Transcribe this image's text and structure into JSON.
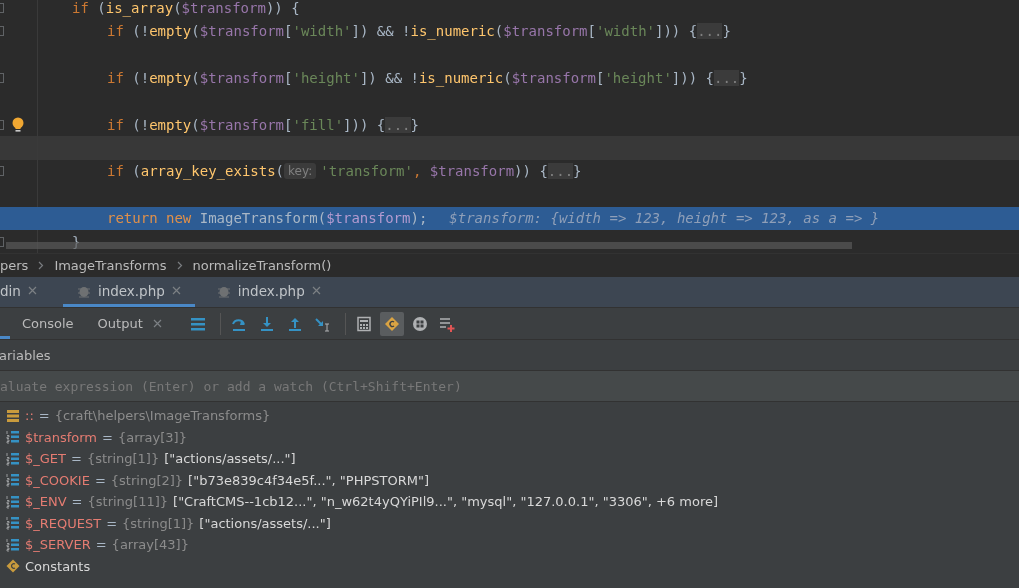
{
  "code": [
    {
      "kind": "code",
      "bulb": false,
      "tokens": [
        {
          "kind": "kw",
          "text": "if "
        },
        {
          "kind": "plain",
          "text": "("
        },
        {
          "kind": "fn",
          "text": "is_array"
        },
        {
          "kind": "plain",
          "text": "("
        },
        {
          "kind": "var",
          "text": "$transform"
        },
        {
          "kind": "plain",
          "text": ")) {"
        }
      ],
      "children": [
        {
          "kind": "code",
          "bulb": false,
          "tokens": [
            {
              "kind": "kw",
              "text": "if "
            },
            {
              "kind": "plain",
              "text": "(!"
            },
            {
              "kind": "fn",
              "text": "empty"
            },
            {
              "kind": "plain",
              "text": "("
            },
            {
              "kind": "var",
              "text": "$transform"
            },
            {
              "kind": "plain",
              "text": "["
            },
            {
              "kind": "str",
              "text": "'width'"
            },
            {
              "kind": "plain",
              "text": "]) && !"
            },
            {
              "kind": "fn",
              "text": "is_numeric"
            },
            {
              "kind": "plain",
              "text": "("
            },
            {
              "kind": "var",
              "text": "$transform"
            },
            {
              "kind": "plain",
              "text": "["
            },
            {
              "kind": "str",
              "text": "'width'"
            },
            {
              "kind": "plain",
              "text": "])) {"
            },
            {
              "kind": "fold",
              "text": "..."
            },
            {
              "kind": "plain",
              "text": "}"
            }
          ]
        },
        {
          "kind": "blank"
        },
        {
          "kind": "code",
          "bulb": false,
          "tokens": [
            {
              "kind": "kw",
              "text": "if "
            },
            {
              "kind": "plain",
              "text": "(!"
            },
            {
              "kind": "fn",
              "text": "empty"
            },
            {
              "kind": "plain",
              "text": "("
            },
            {
              "kind": "var",
              "text": "$transform"
            },
            {
              "kind": "plain",
              "text": "["
            },
            {
              "kind": "str",
              "text": "'height'"
            },
            {
              "kind": "plain",
              "text": "]) && !"
            },
            {
              "kind": "fn",
              "text": "is_numeric"
            },
            {
              "kind": "plain",
              "text": "("
            },
            {
              "kind": "var",
              "text": "$transform"
            },
            {
              "kind": "plain",
              "text": "["
            },
            {
              "kind": "str",
              "text": "'height'"
            },
            {
              "kind": "plain",
              "text": "])) {"
            },
            {
              "kind": "fold",
              "text": "..."
            },
            {
              "kind": "plain",
              "text": "}"
            }
          ]
        },
        {
          "kind": "blank"
        },
        {
          "kind": "code",
          "bulb": true,
          "tokens": [
            {
              "kind": "kw",
              "text": "if "
            },
            {
              "kind": "plain",
              "text": "(!"
            },
            {
              "kind": "fn",
              "text": "empty"
            },
            {
              "kind": "plain",
              "text": "("
            },
            {
              "kind": "var",
              "text": "$transform"
            },
            {
              "kind": "plain",
              "text": "["
            },
            {
              "kind": "str",
              "text": "'fill'"
            },
            {
              "kind": "plain",
              "text": "])) {"
            },
            {
              "kind": "fold",
              "text": "..."
            },
            {
              "kind": "plain",
              "text": "}"
            }
          ]
        },
        {
          "kind": "blank",
          "caret_line": true
        },
        {
          "kind": "code",
          "bulb": false,
          "tokens": [
            {
              "kind": "kw",
              "text": "if "
            },
            {
              "kind": "plain",
              "text": "("
            },
            {
              "kind": "fn",
              "text": "array_key_exists"
            },
            {
              "kind": "plain",
              "text": "("
            },
            {
              "kind": "hint",
              "text": "key:"
            },
            {
              "kind": "str",
              "text": "'transform'"
            },
            {
              "kind": "kw",
              "text": ", "
            },
            {
              "kind": "var",
              "text": "$transform"
            },
            {
              "kind": "plain",
              "text": ")) {"
            },
            {
              "kind": "fold",
              "text": "..."
            },
            {
              "kind": "plain",
              "text": "}"
            }
          ]
        },
        {
          "kind": "blank"
        },
        {
          "kind": "code",
          "bulb": false,
          "execution_line": true,
          "tokens": [
            {
              "kind": "kw",
              "text": "return new "
            },
            {
              "kind": "plain",
              "text": "ImageTransform("
            },
            {
              "kind": "var",
              "text": "$transform"
            },
            {
              "kind": "plain",
              "text": ");"
            },
            {
              "kind": "inline",
              "text": "$transform: {width => 123, height => 123, as a => }"
            }
          ]
        }
      ]
    },
    {
      "kind": "code",
      "bulb": false,
      "tokens": [
        {
          "kind": "plain",
          "text": "}"
        }
      ]
    }
  ],
  "breadcrumbs": [
    "pers",
    "ImageTransforms",
    "normalizeTransform()"
  ],
  "session_tabs": [
    {
      "label": "din",
      "selected": false,
      "icon": false
    },
    {
      "label": "index.php",
      "selected": true,
      "icon": true
    },
    {
      "label": "index.php",
      "selected": false,
      "icon": true
    }
  ],
  "debug_tabs": [
    {
      "label": "Console",
      "closable": false
    },
    {
      "label": "Output",
      "closable": true
    }
  ],
  "toolbar": [
    {
      "kind": "frames",
      "selected": false
    },
    {
      "kind": "separator"
    },
    {
      "kind": "step-over",
      "selected": false
    },
    {
      "kind": "step-into",
      "selected": false
    },
    {
      "kind": "step-out",
      "selected": false
    },
    {
      "kind": "run-to-cursor",
      "selected": false
    },
    {
      "kind": "separator"
    },
    {
      "kind": "evaluate",
      "selected": false
    },
    {
      "kind": "constants",
      "selected": true
    },
    {
      "kind": "grid",
      "selected": false
    },
    {
      "kind": "add-watch",
      "selected": false
    }
  ],
  "variables": {
    "title": "ariables",
    "evaluate_placeholder": "aluate expression (Enter) or add a watch (Ctrl+Shift+Enter)",
    "items": [
      {
        "kind": "object",
        "name": "::",
        "operator": "=",
        "type": "{craft\\helpers\\ImageTransforms}"
      },
      {
        "kind": "array",
        "name": "$transform",
        "operator": "=",
        "type": "{array[3]}"
      },
      {
        "kind": "array",
        "name": "$_GET",
        "operator": "=",
        "type": "{string[1]}",
        "value": "[\"actions/assets/...\"]"
      },
      {
        "kind": "array",
        "name": "$_COOKIE",
        "operator": "=",
        "type": "{string[2]}",
        "value": "[\"b73e839c4f34e5f...\", \"PHPSTORM\"]"
      },
      {
        "kind": "array",
        "name": "$_ENV",
        "operator": "=",
        "type": "{string[11]}",
        "value": "[\"CraftCMS--1cb12...\", \"n_w62t4yQYiPIl9...\", \"mysql\", \"127.0.0.1\", \"3306\", +6 more]"
      },
      {
        "kind": "array",
        "name": "$_REQUEST",
        "operator": "=",
        "type": "{string[1]}",
        "value": "[\"actions/assets/...\"]"
      },
      {
        "kind": "array",
        "name": "$_SERVER",
        "operator": "=",
        "type": "{array[43]}"
      },
      {
        "kind": "constants",
        "label": "Constants"
      }
    ]
  }
}
